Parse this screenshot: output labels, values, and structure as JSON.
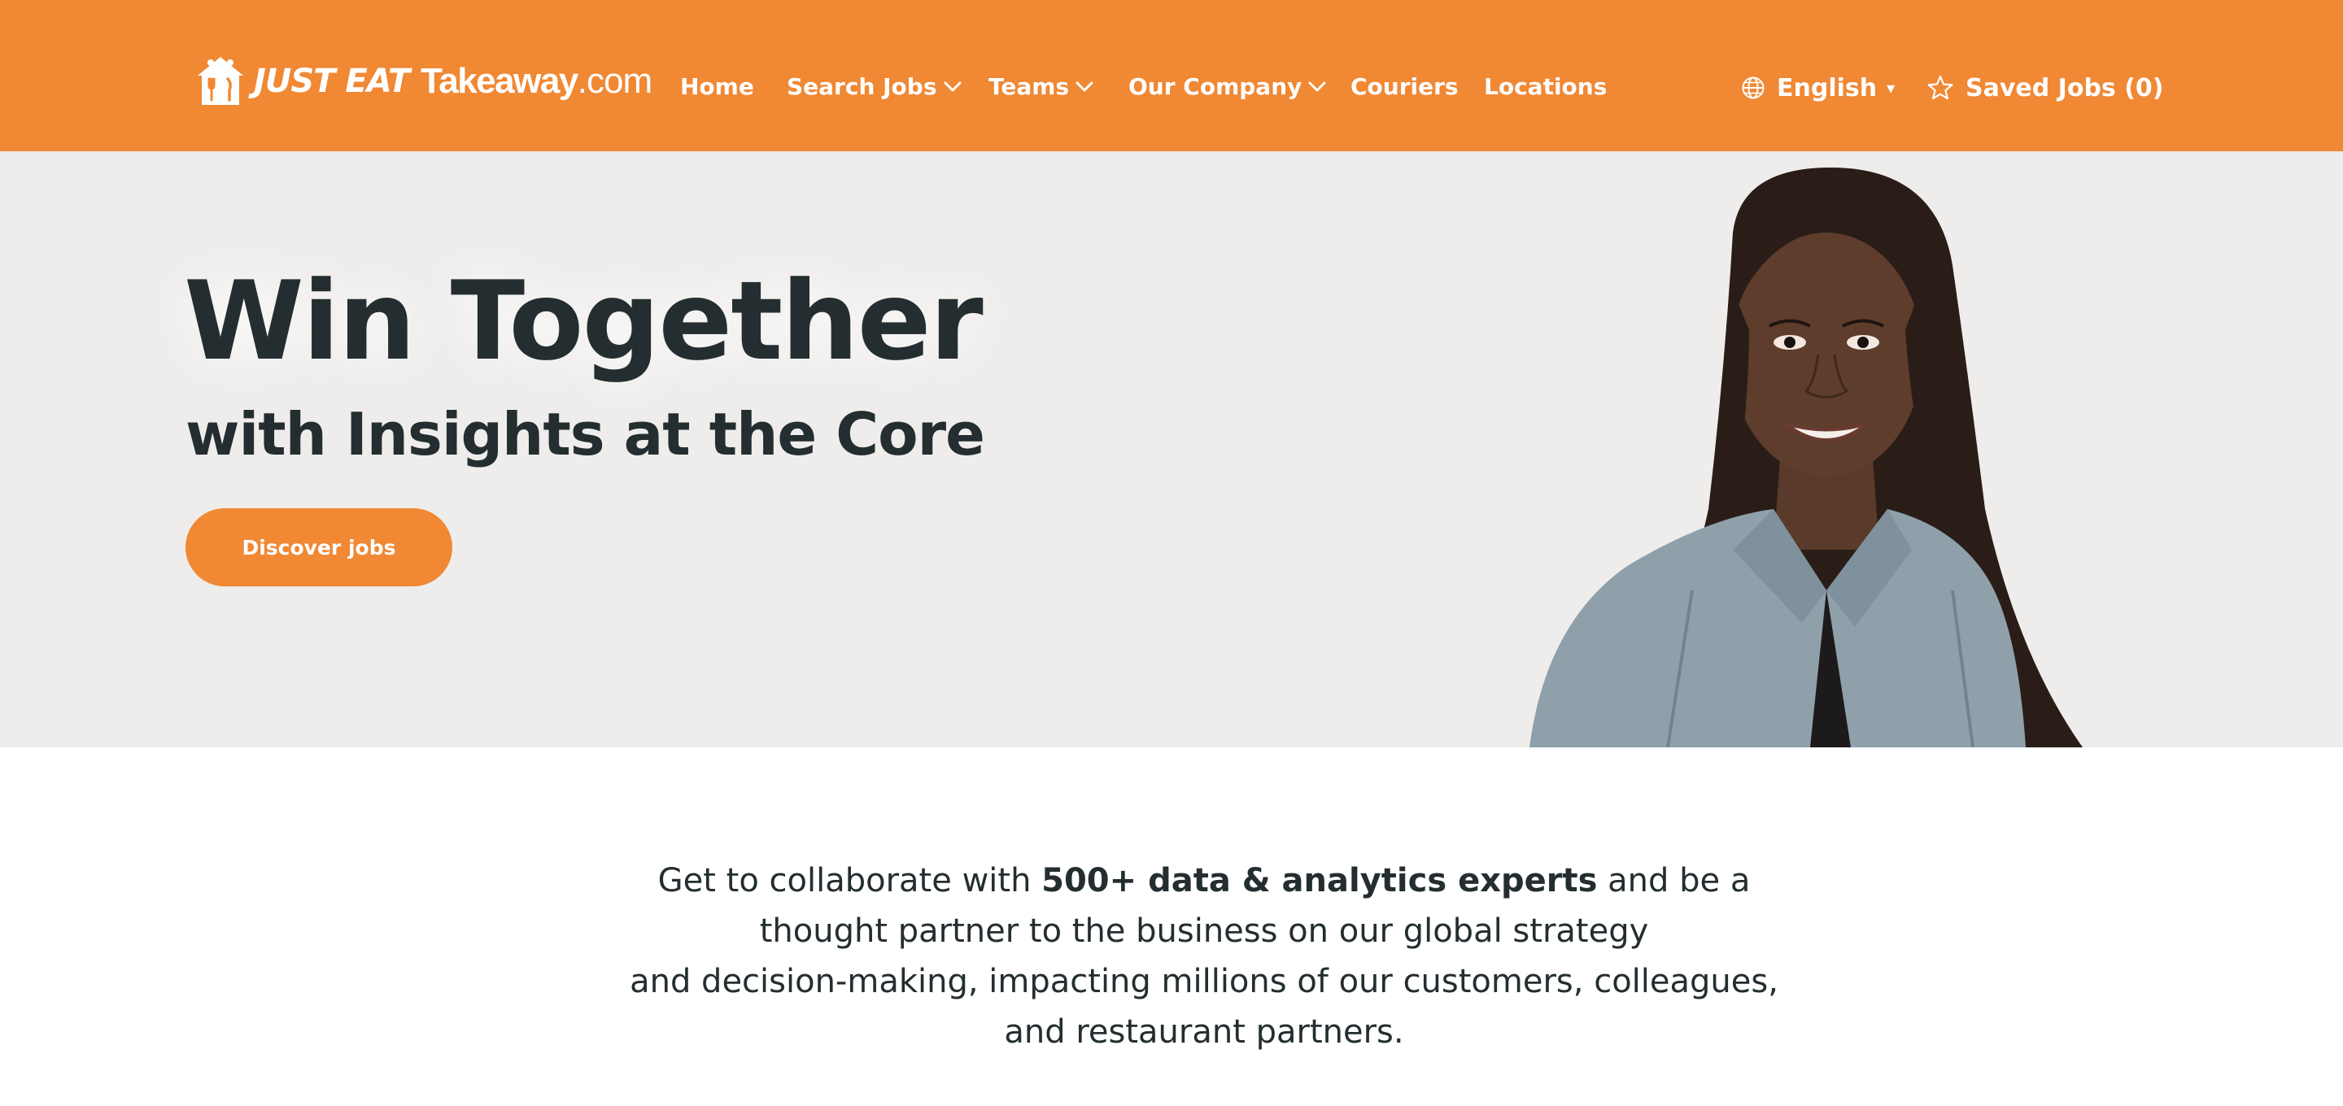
{
  "header": {
    "logo": {
      "text_just_eat": "JUST EAT",
      "text_takeaway": "Takeaway",
      "text_com": ".com"
    },
    "nav": [
      {
        "label": "Home",
        "has_dropdown": false
      },
      {
        "label": "Search Jobs",
        "has_dropdown": true
      },
      {
        "label": "Teams",
        "has_dropdown": true
      },
      {
        "label": "Our Company",
        "has_dropdown": true
      },
      {
        "label": "Couriers",
        "has_dropdown": false
      },
      {
        "label": "Locations",
        "has_dropdown": false
      }
    ],
    "language": {
      "label": "English",
      "icon": "globe-icon",
      "caret": "▾"
    },
    "saved_jobs": {
      "label": "Saved Jobs (0)",
      "icon": "star-icon"
    }
  },
  "hero": {
    "title": "Win Together",
    "subtitle": "with Insights at the Core",
    "cta_label": "Discover jobs",
    "image_alt": "portrait-photo"
  },
  "intro": {
    "line1_before": "Get to collaborate with ",
    "line1_bold": "500+ data & analytics experts",
    "line1_after": " and be a",
    "line2": "thought partner to the business on our global strategy",
    "line3": "and decision-making, impacting millions of our customers, colleagues,",
    "line4": "and restaurant partners."
  },
  "colors": {
    "brand_orange": "#f08834",
    "hero_bg": "#efedeb",
    "text_dark": "#242e30",
    "white": "#ffffff"
  }
}
